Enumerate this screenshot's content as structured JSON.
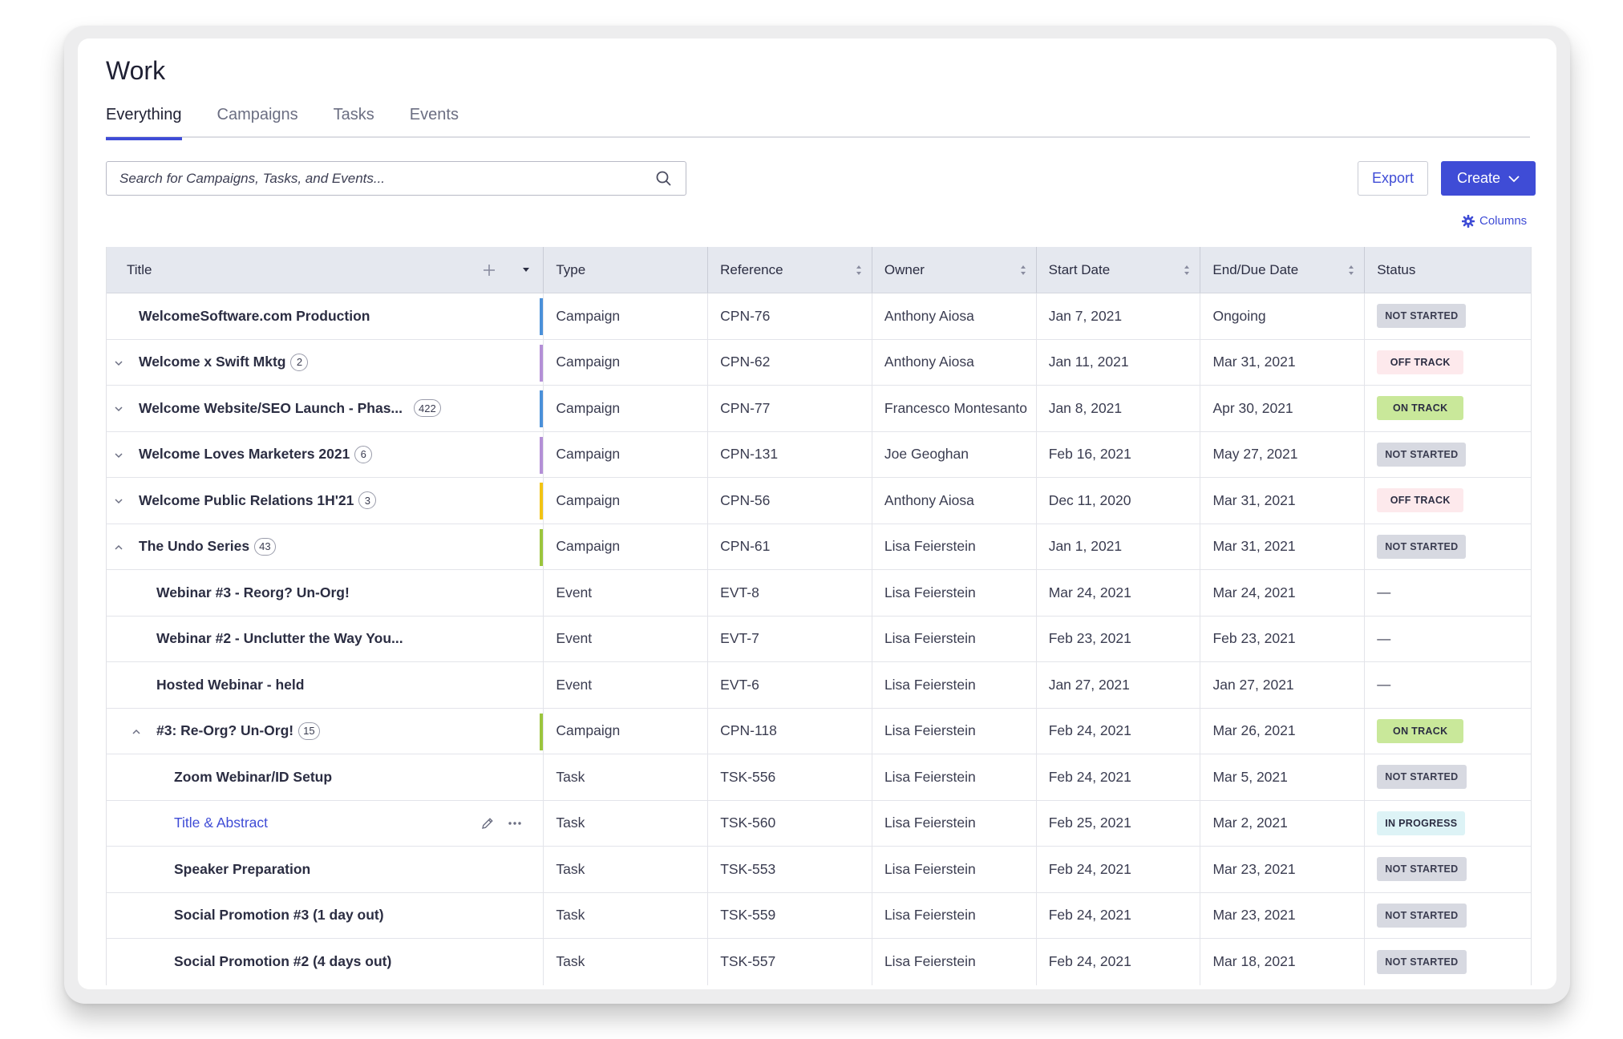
{
  "page": {
    "title": "Work"
  },
  "tabs": [
    "Everything",
    "Campaigns",
    "Tasks",
    "Events"
  ],
  "search": {
    "placeholder": "Search for Campaigns, Tasks, and Events..."
  },
  "toolbar": {
    "export_label": "Export",
    "create_label": "Create",
    "columns_label": "Columns"
  },
  "columns": [
    "Title",
    "Type",
    "Reference",
    "Owner",
    "Start Date",
    "End/Due Date",
    "Status"
  ],
  "colors": {
    "accent": "#3f4cd6",
    "bar_blue": "#4a90d9",
    "bar_purple": "#b48fd6",
    "bar_yellow": "#f2c414",
    "bar_green": "#9bc53d"
  },
  "rows": [
    {
      "title": "WelcomeSoftware.com Production",
      "count": "",
      "type": "Campaign",
      "ref": "CPN-76",
      "owner": "Anthony Aiosa",
      "start": "Jan 7, 2021",
      "end": "Ongoing",
      "status": "NOT STARTED"
    },
    {
      "title": "Welcome x Swift Mktg",
      "count": "2",
      "type": "Campaign",
      "ref": "CPN-62",
      "owner": "Anthony Aiosa",
      "start": "Jan 11, 2021",
      "end": "Mar 31, 2021",
      "status": "OFF TRACK"
    },
    {
      "title": "Welcome Website/SEO Launch - Phas...",
      "count": "422",
      "type": "Campaign",
      "ref": "CPN-77",
      "owner": "Francesco Montesanto",
      "start": "Jan 8, 2021",
      "end": "Apr 30, 2021",
      "status": "ON TRACK"
    },
    {
      "title": "Welcome Loves Marketers 2021",
      "count": "6",
      "type": "Campaign",
      "ref": "CPN-131",
      "owner": "Joe Geoghan",
      "start": "Feb 16, 2021",
      "end": "May 27, 2021",
      "status": "NOT STARTED"
    },
    {
      "title": "Welcome Public Relations 1H'21",
      "count": "3",
      "type": "Campaign",
      "ref": "CPN-56",
      "owner": "Anthony Aiosa",
      "start": "Dec 11, 2020",
      "end": "Mar 31, 2021",
      "status": "OFF TRACK"
    },
    {
      "title": "The Undo Series",
      "count": "43",
      "type": "Campaign",
      "ref": "CPN-61",
      "owner": "Lisa Feierstein",
      "start": "Jan 1, 2021",
      "end": "Mar 31, 2021",
      "status": "NOT STARTED"
    },
    {
      "title": "Webinar #3 - Reorg? Un-Org!",
      "count": "",
      "type": "Event",
      "ref": "EVT-8",
      "owner": "Lisa Feierstein",
      "start": "Mar 24, 2021",
      "end": "Mar 24, 2021",
      "status": "—"
    },
    {
      "title": "Webinar #2 - Unclutter the Way You...",
      "count": "",
      "type": "Event",
      "ref": "EVT-7",
      "owner": "Lisa Feierstein",
      "start": "Feb 23, 2021",
      "end": "Feb 23, 2021",
      "status": "—"
    },
    {
      "title": "Hosted Webinar - held",
      "count": "",
      "type": "Event",
      "ref": "EVT-6",
      "owner": "Lisa Feierstein",
      "start": "Jan 27, 2021",
      "end": "Jan 27, 2021",
      "status": "—"
    },
    {
      "title": "#3: Re-Org? Un-Org!",
      "count": "15",
      "type": "Campaign",
      "ref": "CPN-118",
      "owner": "Lisa Feierstein",
      "start": "Feb 24, 2021",
      "end": "Mar 26, 2021",
      "status": "ON TRACK"
    },
    {
      "title": "Zoom Webinar/ID Setup",
      "count": "",
      "type": "Task",
      "ref": "TSK-556",
      "owner": "Lisa Feierstein",
      "start": "Feb 24, 2021",
      "end": "Mar 5, 2021",
      "status": "NOT STARTED"
    },
    {
      "title": "Title & Abstract",
      "count": "",
      "type": "Task",
      "ref": "TSK-560",
      "owner": "Lisa Feierstein",
      "start": "Feb 25, 2021",
      "end": "Mar 2, 2021",
      "status": "IN PROGRESS"
    },
    {
      "title": "Speaker Preparation",
      "count": "",
      "type": "Task",
      "ref": "TSK-553",
      "owner": "Lisa Feierstein",
      "start": "Feb 24, 2021",
      "end": "Mar 23, 2021",
      "status": "NOT STARTED"
    },
    {
      "title": "Social Promotion #3 (1 day out)",
      "count": "",
      "type": "Task",
      "ref": "TSK-559",
      "owner": "Lisa Feierstein",
      "start": "Feb 24, 2021",
      "end": "Mar 23, 2021",
      "status": "NOT STARTED"
    },
    {
      "title": "Social Promotion #2 (4 days out)",
      "count": "",
      "type": "Task",
      "ref": "TSK-557",
      "owner": "Lisa Feierstein",
      "start": "Feb 24, 2021",
      "end": "Mar 18, 2021",
      "status": "NOT STARTED"
    }
  ]
}
